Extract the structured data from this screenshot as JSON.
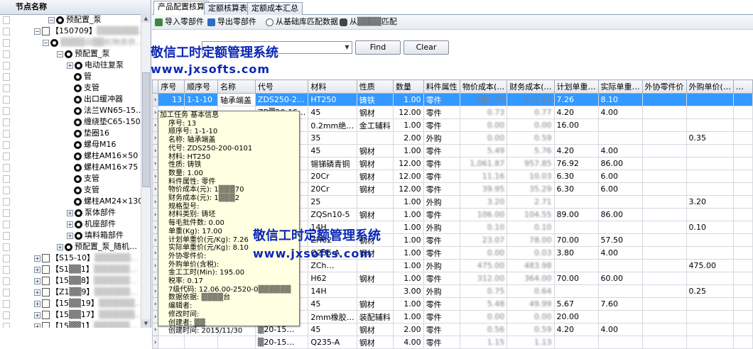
{
  "tree": {
    "header": "节点名称",
    "rows": [
      {
        "indent": 68,
        "exp": "−",
        "icon": "gear",
        "label": "预配置_泵",
        "blur": ""
      },
      {
        "indent": 48,
        "exp": "−",
        "icon": "doc",
        "label": "【150709】",
        "blur": "▒▒▒▒▒▒▒…"
      },
      {
        "indent": 60,
        "exp": "−",
        "icon": "gear",
        "label": "",
        "blur": "▒▒▒▒田▒▒机物资供…"
      },
      {
        "indent": 80,
        "exp": "−",
        "icon": "gear",
        "label": "预配置_泵",
        "blur": ""
      },
      {
        "indent": 94,
        "exp": "+",
        "icon": "gear",
        "label": "电动往复泵",
        "blur": ""
      },
      {
        "indent": 104,
        "exp": "",
        "icon": "gear",
        "label": "管",
        "blur": ""
      },
      {
        "indent": 104,
        "exp": "",
        "icon": "gear",
        "label": "支管",
        "blur": ""
      },
      {
        "indent": 104,
        "exp": "",
        "icon": "gear",
        "label": "出口缓冲器",
        "blur": ""
      },
      {
        "indent": 104,
        "exp": "",
        "icon": "gear",
        "label": "法兰WN65-15…",
        "blur": ""
      },
      {
        "indent": 104,
        "exp": "",
        "icon": "gear",
        "label": "缠绕垫C65-150",
        "blur": ""
      },
      {
        "indent": 104,
        "exp": "",
        "icon": "gear",
        "label": "垫圈16",
        "blur": ""
      },
      {
        "indent": 104,
        "exp": "",
        "icon": "gear",
        "label": "螺母M16",
        "blur": ""
      },
      {
        "indent": 104,
        "exp": "",
        "icon": "gear",
        "label": "螺柱AM16×50",
        "blur": ""
      },
      {
        "indent": 104,
        "exp": "",
        "icon": "gear",
        "label": "螺柱AM16×75",
        "blur": ""
      },
      {
        "indent": 104,
        "exp": "",
        "icon": "gear",
        "label": "支管",
        "blur": ""
      },
      {
        "indent": 104,
        "exp": "",
        "icon": "gear",
        "label": "支管",
        "blur": ""
      },
      {
        "indent": 104,
        "exp": "",
        "icon": "gear",
        "label": "螺柱AM24×130",
        "blur": ""
      },
      {
        "indent": 94,
        "exp": "+",
        "icon": "gear",
        "label": "泵体部件",
        "blur": ""
      },
      {
        "indent": 94,
        "exp": "+",
        "icon": "gear",
        "label": "机座部件",
        "blur": ""
      },
      {
        "indent": 94,
        "exp": "+",
        "icon": "gear",
        "label": "填料箱部件",
        "blur": ""
      },
      {
        "indent": 80,
        "exp": "+",
        "icon": "gear",
        "label": "预配置_泵_随机…",
        "blur": ""
      },
      {
        "indent": 48,
        "exp": "+",
        "icon": "doc",
        "label": "【S15-10】",
        "blur": "▒▒▒▒▒▒…"
      },
      {
        "indent": 48,
        "exp": "+",
        "icon": "doc",
        "label": "【S1▒▒1】",
        "blur": "▒▒▒▒▒▒…"
      },
      {
        "indent": 48,
        "exp": "+",
        "icon": "doc",
        "label": "【15▒▒8】",
        "blur": "▒▒▒▒▒▒…"
      },
      {
        "indent": 48,
        "exp": "+",
        "icon": "doc",
        "label": "【Z1▒▒9】",
        "blur": "▒▒▒▒▒▒…"
      },
      {
        "indent": 48,
        "exp": "+",
        "icon": "doc",
        "label": "【15▒▒19】",
        "blur": "▒▒▒▒▒▒…"
      },
      {
        "indent": 48,
        "exp": "+",
        "icon": "doc",
        "label": "【15▒▒17】",
        "blur": "▒▒▒▒▒▒…"
      },
      {
        "indent": 48,
        "exp": "+",
        "icon": "doc",
        "label": "【15▒▒1】",
        "blur": "▒▒▒▒▒▒…"
      },
      {
        "indent": 48,
        "exp": "+",
        "icon": "doc",
        "label": "【15▒▒1】",
        "blur": "▒▒▒▒▒▒…"
      },
      {
        "indent": 48,
        "exp": "+",
        "icon": "doc",
        "label": "【1▒▒▒】",
        "blur": "▒▒▒▒▒▒…"
      }
    ]
  },
  "tabs": [
    "产品配置核算",
    "定额核算表",
    "定额成本汇总"
  ],
  "toolbar": {
    "import": "导入零部件",
    "export": "导出零部件",
    "match_base": "从基础库匹配数据",
    "match_other": "从▒▒▒▒匹配"
  },
  "filter": {
    "find": "Find",
    "clear": "Clear",
    "combo_value": ""
  },
  "watermark": {
    "title": "敬信工时定额管理系统",
    "url": "www.jxsofts.com"
  },
  "grid": {
    "columns": [
      "序号",
      "顺序号",
      "名称",
      "代号",
      "材料",
      "性质",
      "数量",
      "料件属性",
      "物价成本(…",
      "财务成本(…",
      "计划单重…",
      "实际单重…",
      "外协零件价",
      "外购单价(…",
      "…"
    ],
    "rows": [
      {
        "c": [
          "13",
          "1-1-10",
          "轴承端盖",
          "ZDS250-2…",
          "HT250",
          "铸铁",
          "1.00",
          "零件",
          "1▒7.70",
          "123.42",
          "7.26",
          "8.10",
          "",
          "",
          ""
        ],
        "sel": true
      },
      {
        "c": [
          "",
          "",
          "",
          "ZD▒20-15…",
          "45",
          "钢材",
          "12.00",
          "零件",
          "0.73",
          "0.77",
          "4.20",
          "4.00",
          "",
          "",
          ""
        ]
      },
      {
        "c": [
          "",
          "",
          "",
          "▒D-φ2…",
          "0.2mm绝…",
          "金工辅料",
          "1.00",
          "零件",
          "0.00",
          "0.00",
          "16.00",
          "",
          "",
          "",
          ""
        ]
      },
      {
        "c": [
          "",
          "",
          "",
          "▒T119.2",
          "35",
          "",
          "2.00",
          "外购",
          "0.00",
          "0.59",
          "",
          "",
          "",
          "0.35",
          ""
        ]
      },
      {
        "c": [
          "",
          "",
          "",
          "▒20-15…",
          "45",
          "钢材",
          "1.00",
          "零件",
          "5.49",
          "5.76",
          "4.20",
          "4.00",
          "",
          "",
          ""
        ]
      },
      {
        "c": [
          "",
          "",
          "",
          "▒20-15…",
          "锡锑磷青铜",
          "钢材",
          "12.00",
          "零件",
          "1,061.87",
          "957.85",
          "76.92",
          "86.00",
          "",
          "",
          ""
        ]
      },
      {
        "c": [
          "",
          "",
          "",
          "▒20-15…",
          "20Cr",
          "钢材",
          "12.00",
          "零件",
          "11.16",
          "10.03",
          "6.30",
          "6.00",
          "",
          "",
          ""
        ]
      },
      {
        "c": [
          "",
          "",
          "",
          "▒20-15…",
          "20Cr",
          "钢材",
          "12.00",
          "零件",
          "39.95",
          "35.29",
          "6.30",
          "6.00",
          "",
          "",
          ""
        ]
      },
      {
        "c": [
          "",
          "",
          "",
          "▒T825",
          "25",
          "",
          "1.00",
          "外购",
          "3.20",
          "2.71",
          "",
          "",
          "",
          "3.20",
          ""
        ]
      },
      {
        "c": [
          "",
          "",
          "",
          "▒20-15…",
          "ZQSn10-5",
          "钢材",
          "1.00",
          "零件",
          "106.00",
          "104.55",
          "89.00",
          "86.00",
          "",
          "",
          ""
        ]
      },
      {
        "c": [
          "",
          "",
          "",
          "▒T73",
          "14H",
          "",
          "1.00",
          "外购",
          "0.10",
          "0.10",
          "",
          "",
          "",
          "0.10",
          ""
        ]
      },
      {
        "c": [
          "",
          "",
          "",
          "▒20-15…",
          "ZH62",
          "钢材",
          "1.00",
          "零件",
          "23.07",
          "78.00",
          "70.00",
          "57.50",
          "",
          "",
          ""
        ]
      },
      {
        "c": [
          "",
          "",
          "",
          "▒20-15…",
          "Q235-A",
          "钢材",
          "1.00",
          "零件",
          "0.00",
          "0.03",
          "3.80",
          "4.00",
          "",
          "",
          ""
        ]
      },
      {
        "c": [
          "",
          "",
          "",
          "▒20-15…",
          "ZCh…",
          "",
          "1.00",
          "外购",
          "475.00",
          "483.98",
          "",
          "",
          "",
          "475.00",
          ""
        ]
      },
      {
        "c": [
          "",
          "",
          "",
          "▒20-15…",
          "H62",
          "钢材",
          "1.00",
          "零件",
          "312.00",
          "364.00",
          "70.00",
          "60.00",
          "",
          "",
          ""
        ]
      },
      {
        "c": [
          "",
          "",
          "",
          "▒T71",
          "14H",
          "",
          "3.00",
          "外购",
          "0.75",
          "0.64",
          "",
          "",
          "",
          "0.25",
          ""
        ]
      },
      {
        "c": [
          "",
          "",
          "",
          "▒20-15…",
          "45",
          "钢材",
          "1.00",
          "零件",
          "5.48",
          "49.99",
          "5.67",
          "7.60",
          "",
          "",
          ""
        ]
      },
      {
        "c": [
          "",
          "",
          "",
          "▒D-14…",
          "2mm橡胶…",
          "装配辅料",
          "1.00",
          "零件",
          "0.00",
          "0.00",
          "20.00",
          "",
          "",
          "",
          ""
        ]
      },
      {
        "c": [
          "",
          "",
          "",
          "▒20-15…",
          "45",
          "钢材",
          "2.00",
          "零件",
          "0.56",
          "0.59",
          "4.20",
          "4.00",
          "",
          "",
          ""
        ]
      },
      {
        "c": [
          "",
          "",
          "",
          "▒20-15…",
          "Q235-A",
          "钢材",
          "4.00",
          "零件",
          "1.15",
          "1.13",
          "",
          "",
          "",
          "",
          ""
        ]
      }
    ]
  },
  "tooltip": {
    "title": "加工任务  基本信息",
    "lines": [
      "序号: 13",
      "顺序号: 1-1-10",
      "名称: 轴承端盖",
      "代号: ZDS250-200-0101",
      "材料: HT250",
      "性质: 铸铁",
      "数量: 1.00",
      "料件属性: 零件",
      "物价成本(元): 1▒▒▒70",
      "财务成本(元): 1▒▒▒2",
      "规格型号:",
      "材料类别: 铸坯",
      "每毛批件数: 0.00",
      "单重(Kg): 17.00",
      "计划单重价(元/Kg): 7.26",
      "实际单重价(元/Kg): 8.10",
      "外协零件价:",
      "外购单价(含税):",
      "金工工时(Min): 195.00",
      "税率: 0.17",
      "7级代码: 12.06.00-2520-0▒▒▒▒▒▒",
      "数据依据: ▒▒▒▒台",
      "编辑者:",
      "修改时间:",
      "创建者: ▒▒",
      "创建时间: 2015/11/30"
    ]
  },
  "colors": {
    "selection": "#3399ff",
    "watermark": "#0b27b5",
    "tooltip_bg": "#ffffe1"
  }
}
